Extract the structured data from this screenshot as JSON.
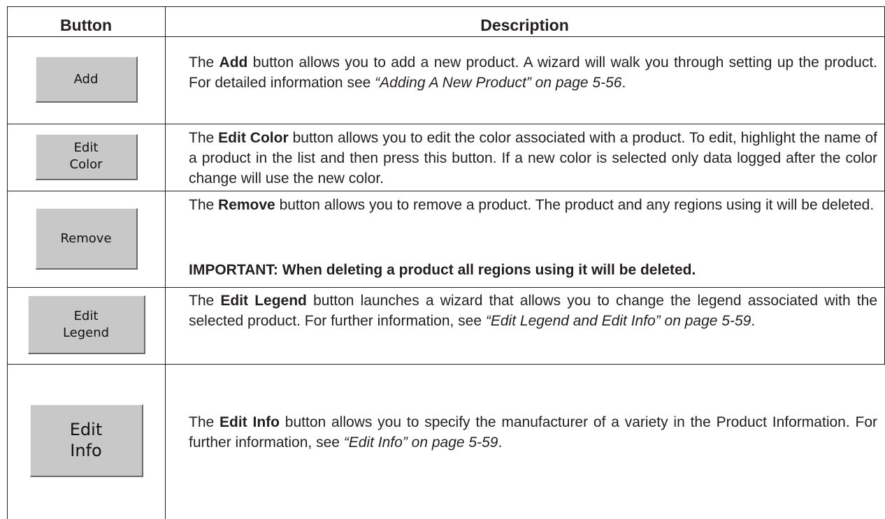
{
  "table": {
    "headers": {
      "button": "Button",
      "description": "Description"
    },
    "rows": [
      {
        "button_lines": [
          "Add"
        ],
        "desc_pre": "The ",
        "desc_bold": "Add",
        "desc_mid": " button allows you to add a new product. A wizard will walk you through setting up the product. For detailed information see ",
        "desc_italic": "“Adding A New Product” on page 5-56",
        "desc_post": "."
      },
      {
        "button_lines": [
          "Edit",
          "Color"
        ],
        "desc_pre": "The ",
        "desc_bold": "Edit Color",
        "desc_mid": " button allows you to edit the color associated with a product.  To edit, highlight the name of a product in the list and then press this button.  If a new color is selected only data logged after the color change will use the new color.",
        "desc_italic": "",
        "desc_post": ""
      },
      {
        "button_lines": [
          "Remove"
        ],
        "desc_pre": "The ",
        "desc_bold": "Remove",
        "desc_mid": " button allows you to remove a product. The product and any regions using it will be deleted.",
        "desc_italic": "",
        "desc_post": "",
        "important": "IMPORTANT: When deleting a product all regions using it will be deleted."
      },
      {
        "button_lines": [
          "Edit",
          "Legend"
        ],
        "desc_pre": "The ",
        "desc_bold": "Edit Legend",
        "desc_mid": " button launches a wizard that allows you to change the legend associated with the selected product. For further information, see ",
        "desc_italic": "“Edit Legend and Edit Info” on page 5-59",
        "desc_post": "."
      },
      {
        "button_lines": [
          "Edit",
          "Info"
        ],
        "desc_pre": "The ",
        "desc_bold": "Edit Info",
        "desc_mid": " button allows you to specify the manufacturer of a variety in the Product Information. For further information, see ",
        "desc_italic": "“Edit Info” on page 5-59",
        "desc_post": "."
      }
    ]
  }
}
